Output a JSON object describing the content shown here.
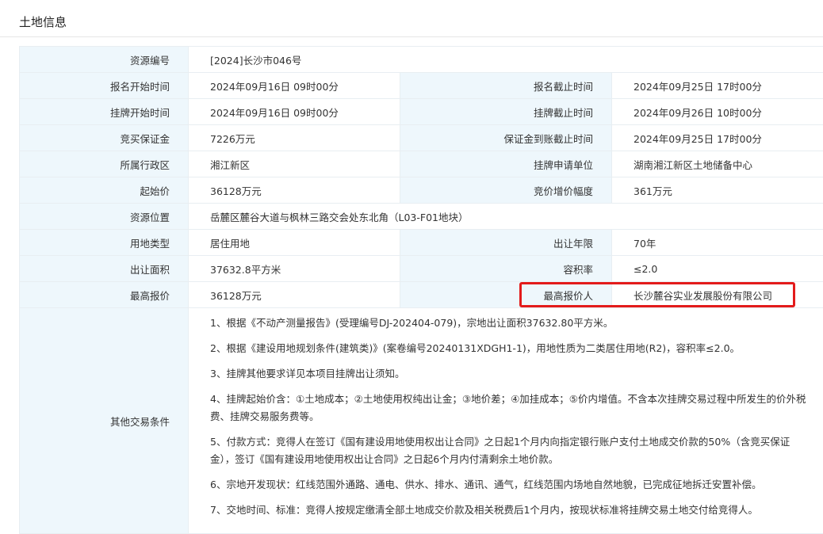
{
  "section_title": "土地信息",
  "rows": {
    "r1": {
      "l1": "资源编号",
      "v1": "[2024]长沙市046号"
    },
    "r2": {
      "l1": "报名开始时间",
      "v1": "2024年09月16日 09时00分",
      "l2": "报名截止时间",
      "v2": "2024年09月25日 17时00分"
    },
    "r3": {
      "l1": "挂牌开始时间",
      "v1": "2024年09月16日 09时00分",
      "l2": "挂牌截止时间",
      "v2": "2024年09月26日 10时00分"
    },
    "r4": {
      "l1": "竞买保证金",
      "v1": "7226万元",
      "l2": "保证金到账截止时间",
      "v2": "2024年09月25日 17时00分"
    },
    "r5": {
      "l1": "所属行政区",
      "v1": "湘江新区",
      "l2": "挂牌申请单位",
      "v2": "湖南湘江新区土地储备中心"
    },
    "r6": {
      "l1": "起始价",
      "v1": "36128万元",
      "l2": "竞价增价幅度",
      "v2": "361万元"
    },
    "r7": {
      "l1": "资源位置",
      "v1": "岳麓区麓谷大道与枫林三路交会处东北角（L03-F01地块）"
    },
    "r8": {
      "l1": "用地类型",
      "v1": "居住用地",
      "l2": "出让年限",
      "v2": "70年"
    },
    "r9": {
      "l1": "出让面积",
      "v1": "37632.8平方米",
      "l2": "容积率",
      "v2": "≤2.0"
    },
    "r10": {
      "l1": "最高报价",
      "v1": "36128万元",
      "l2": "最高报价人",
      "v2": "长沙麓谷实业发展股份有限公司"
    }
  },
  "conditions": {
    "label": "其他交易条件",
    "items": [
      "1、根据《不动产测量报告》(受理编号DJ-202404-079)，宗地出让面积37632.80平方米。",
      "2、根据《建设用地规划条件(建筑类)》(案卷编号20240131XDGH1-1)，用地性质为二类居住用地(R2)，容积率≤2.0。",
      "3、挂牌其他要求详见本项目挂牌出让须知。",
      "4、挂牌起始价含：①土地成本；②土地使用权纯出让金；③地价差；④加挂成本；⑤价内增值。不含本次挂牌交易过程中所发生的价外税费、挂牌交易服务费等。",
      "5、付款方式：竞得人在签订《国有建设用地使用权出让合同》之日起1个月内向指定银行账户支付土地成交价款的50%（含竞买保证金），签订《国有建设用地使用权出让合同》之日起6个月内付清剩余土地价款。",
      "6、宗地开发现状：红线范围外通路、通电、供水、排水、通讯、通气，红线范围内场地自然地貌，已完成征地拆迁安置补偿。",
      "7、交地时间、标准：竞得人按规定缴清全部土地成交价款及相关税费后1个月内，按现状标准将挂牌交易土地交付给竞得人。"
    ]
  },
  "colors": {
    "label_bg": "#eef7fc",
    "highlight_border": "#e31b1b"
  }
}
